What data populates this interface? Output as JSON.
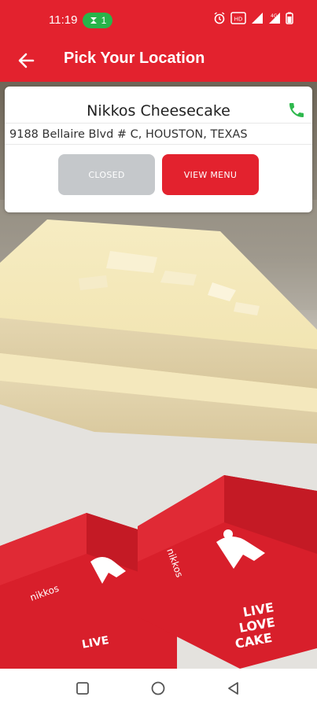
{
  "status_bar": {
    "time": "11:19",
    "pill_count": "1",
    "icons": [
      "alarm-icon",
      "nfc-icon",
      "wifi-icon",
      "signal-icon",
      "battery-icon"
    ],
    "background": "#e3222e"
  },
  "app_bar": {
    "title": "Pick Your Location",
    "back_icon": "arrow-left-icon"
  },
  "location": {
    "name": "Nikkos Cheesecake",
    "address": "9188 Bellaire Blvd # C, HOUSTON, TEXAS",
    "status_label": "CLOSED",
    "menu_label": "VIEW MENU",
    "phone_icon": "phone-icon"
  },
  "hero": {
    "box_text_1": "LIVE",
    "box_text_2": "LOVE",
    "box_text_3": "CAKE",
    "brand_text": "nikkos"
  },
  "colors": {
    "brand": "#e3222e",
    "phone": "#2eb84d",
    "closed": "#c5c8cb"
  },
  "nav_bar": {
    "items": [
      "recents-square-icon",
      "home-circle-icon",
      "back-triangle-icon"
    ]
  }
}
